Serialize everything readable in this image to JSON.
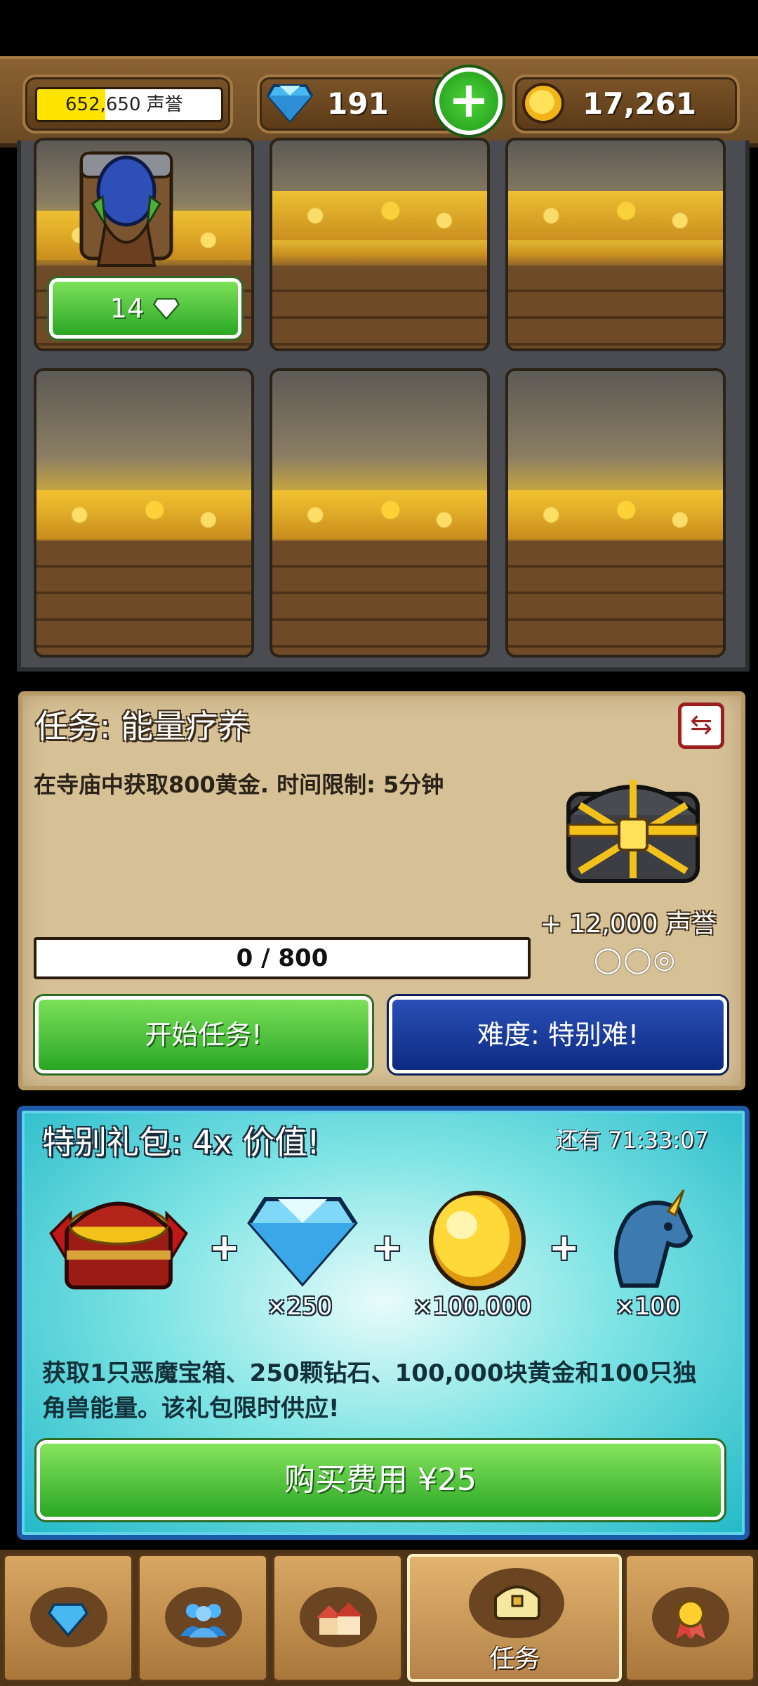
{
  "top_bar": {
    "reputation": "652,650 声誉",
    "reputation_progress": 0.37,
    "gems": "191",
    "gold": "17,261"
  },
  "vault": {
    "slots": 6,
    "occupied_slot_skip_cost": "14"
  },
  "quest": {
    "title": "任务: 能量疗养",
    "description": "在寺庙中获取800黄金. 时间限制: 5分钟",
    "reward": "+ 12,000 声誉",
    "progress": "0 / 800",
    "progress_fraction": 0,
    "difficulty_rings": "◯◯◎",
    "start_label": "开始任务!",
    "difficulty_label": "难度: 特别难!"
  },
  "offer": {
    "title": "特别礼包:  4x 价值!",
    "timer": "还有 71:33:07",
    "gems_qty": "×250",
    "gold_qty": "×100.000",
    "unicorn_qty": "×100",
    "plus": "+",
    "description": "获取1只恶魔宝箱、250颗钻石、100,000块黄金和100只独角兽能量。该礼包限时供应!",
    "buy_label": "购买费用 ¥25"
  },
  "nav": {
    "active_tab_label": "任务"
  },
  "colors": {
    "green_button": "#2aa724",
    "blue_button": "#0c2a82",
    "offer_border": "#1d5aa8",
    "parchment": "#d6c196"
  }
}
